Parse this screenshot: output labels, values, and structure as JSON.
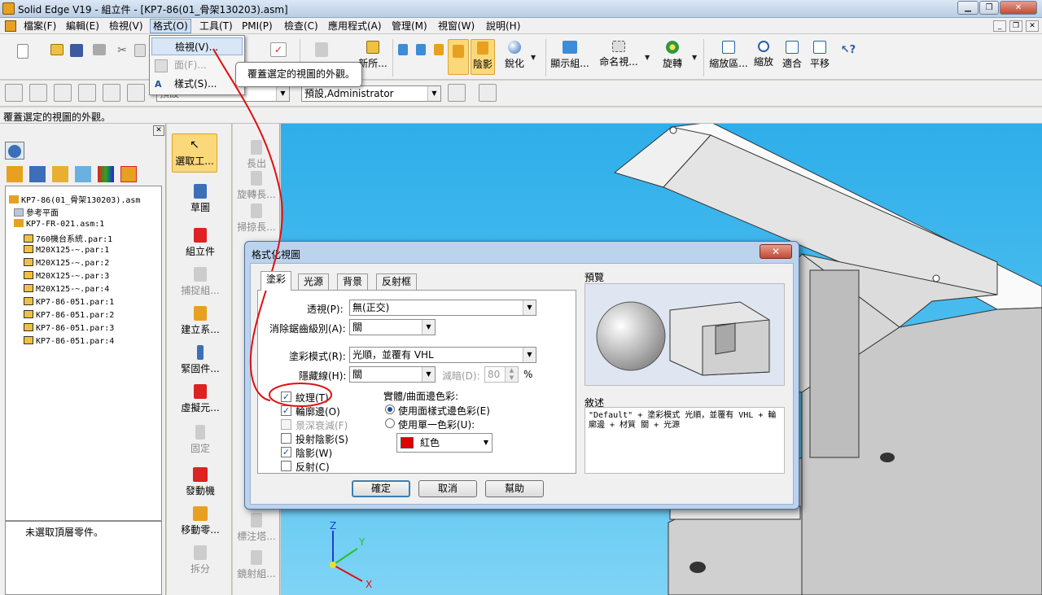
{
  "window": {
    "title": "Solid Edge V19 - 組立件 - [KP7-86(01_骨架130203).asm]"
  },
  "menubar": {
    "items": [
      "檔案(F)",
      "編輯(E)",
      "檢視(V)",
      "格式(O)",
      "工具(T)",
      "PMI(P)",
      "檢查(C)",
      "應用程式(A)",
      "管理(M)",
      "視窗(W)",
      "說明(H)"
    ],
    "active": "格式(O)"
  },
  "format_menu": {
    "items": [
      "檢視(V)...",
      "面(F)...",
      "樣式(S)..."
    ]
  },
  "tooltip": "覆蓋選定的視圖的外觀。",
  "ribbon": {
    "labels": [
      "新所...",
      "陰影",
      "銳化",
      "顯示組...",
      "命名視...",
      "旋轉",
      "縮放區...",
      "縮放",
      "適合",
      "平移"
    ]
  },
  "toolbar2": {
    "combo_left": "預設",
    "combo_right": "預設,Administrator"
  },
  "status": "覆蓋選定的視圖的外觀。",
  "tree": {
    "root": "KP7-86(01_骨架130203).asm",
    "items": [
      "參考平面",
      "KP7-FR-021.asm:1",
      "760機台系統.par:1",
      "M20X125-~.par:1",
      "M20X125-~.par:2",
      "M20X125-~.par:3",
      "M20X125-~.par:4",
      "KP7-86-051.par:1",
      "KP7-86-051.par:2",
      "KP7-86-051.par:3",
      "KP7-86-051.par:4"
    ]
  },
  "info_text": "未選取頂層零件。",
  "commands": {
    "col1": [
      "選取工...",
      "草圖",
      "組立件",
      "捕捉組...",
      "建立系...",
      "緊固件...",
      "虛擬元...",
      "固定",
      "發動機",
      "移動零...",
      "拆分"
    ],
    "col2": [
      "長出",
      "旋轉長...",
      "掃掠長...",
      "標注塔...",
      "鏡射組..."
    ]
  },
  "dialog": {
    "title": "格式化視圖",
    "tabs": [
      "塗彩",
      "光源",
      "背景",
      "反射框"
    ],
    "fields": {
      "perspective_label": "透視(P):",
      "perspective_value": "無(正交)",
      "antialias_label": "消除鋸齒級別(A):",
      "antialias_value": "關",
      "render_label": "塗彩模式(R):",
      "render_value": "光順，並覆有 VHL",
      "hidden_label": "隱藏線(H):",
      "hidden_value": "關",
      "dim_label": "減暗(D):",
      "dim_value": "80",
      "dim_unit": "%"
    },
    "checks": [
      {
        "label": "紋理(T)",
        "checked": true,
        "enabled": true
      },
      {
        "label": "輪廓邊(O)",
        "checked": true,
        "enabled": true
      },
      {
        "label": "景深衰減(F)",
        "checked": false,
        "enabled": false
      },
      {
        "label": "投射陰影(S)",
        "checked": false,
        "enabled": true
      },
      {
        "label": "陰影(W)",
        "checked": true,
        "enabled": true
      },
      {
        "label": "反射(C)",
        "checked": false,
        "enabled": true
      }
    ],
    "edge_color_title": "實體/曲面邊色彩:",
    "radio1": "使用面樣式邊色彩(E)",
    "radio2": "使用單一色彩(U):",
    "color_value": "紅色",
    "preview_title": "預覽",
    "desc_title": "敘述",
    "description": "\"Default\" + 塗彩模式 光順，並覆有 VHL + 輪廓邊 + 材質 關 + 光源",
    "buttons": [
      "確定",
      "取消",
      "幫助"
    ]
  },
  "axes": {
    "z": "Z",
    "y": "Y",
    "x": "X"
  },
  "colors": {
    "highlight": "#fbd87a",
    "annotation": "#e01010",
    "swatch": "#e00000"
  }
}
